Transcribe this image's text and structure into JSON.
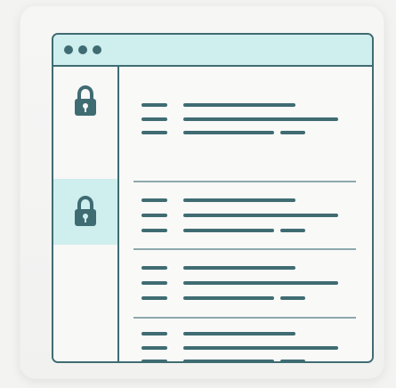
{
  "window": {
    "dots": 3,
    "sidebar_items": [
      {
        "icon": "lock-icon",
        "selected": false
      },
      {
        "icon": "lock-icon",
        "selected": true
      }
    ],
    "content_rows": 4
  },
  "colors": {
    "accent": "#3f6c72",
    "highlight": "#cfeeee",
    "background": "#f3f3f2"
  }
}
